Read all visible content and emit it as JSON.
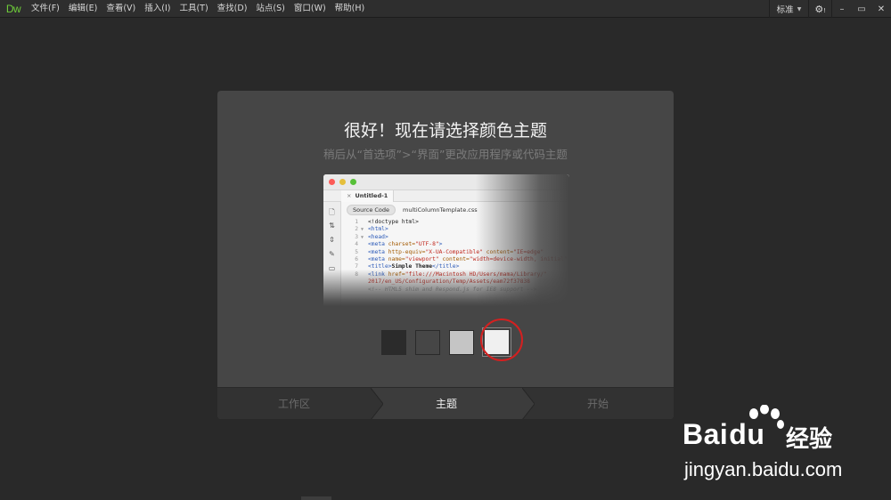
{
  "app": {
    "logo": "Dw"
  },
  "menu": [
    "文件(F)",
    "编辑(E)",
    "查看(V)",
    "插入(I)",
    "工具(T)",
    "查找(D)",
    "站点(S)",
    "窗口(W)",
    "帮助(H)"
  ],
  "toolbar_right": {
    "workspace": "标准",
    "settings_icon": "gear-icon",
    "minimize": "–",
    "restore": "▭",
    "close": "✕"
  },
  "dialog": {
    "title": "很好！现在请选择颜色主题",
    "subtitle": "稍后从“首选项”>“界面”更改应用程序或代码主题",
    "preview": {
      "tab": "Untitled-1",
      "tab_close": "×",
      "source_button": "Source Code",
      "related_file": "multiColumnTemplate.css",
      "code_lines": [
        {
          "n": "1",
          "fold": "",
          "html": "<span class='tx'>&lt;!doctype html&gt;</span>"
        },
        {
          "n": "2",
          "fold": "▼",
          "html": "<span class='tag'>&lt;html&gt;</span>"
        },
        {
          "n": "3",
          "fold": "▼",
          "html": "<span class='tag'>&lt;head&gt;</span>"
        },
        {
          "n": "4",
          "fold": "",
          "html": "<span class='tag'>&lt;meta</span> <span class='att'>charset=</span><span class='str'>\"UTF-8\"</span><span class='tag'>&gt;</span>"
        },
        {
          "n": "5",
          "fold": "",
          "html": "<span class='tag'>&lt;meta</span> <span class='att'>http-equiv=</span><span class='str'>\"X-UA-Compatible\"</span> <span class='att'>content=</span><span class='str'>\"IE=edge\"</span>"
        },
        {
          "n": "6",
          "fold": "",
          "html": "<span class='tag'>&lt;meta</span> <span class='att'>name=</span><span class='str'>\"viewport\"</span> <span class='att'>content=</span><span class='str'>\"width=device-width, initial\"</span>"
        },
        {
          "n": "7",
          "fold": "",
          "html": "<span class='tag'>&lt;title&gt;</span><span class='bk'>Simple Theme</span><span class='tag'>&lt;/title&gt;</span>"
        },
        {
          "n": "8",
          "fold": "",
          "html": "<span class='tag'>&lt;link</span> <span class='att'>href=</span><span class='str'>\"file:///Macintosh HD/Users/mama/Library/\"</span>"
        },
        {
          "n": "",
          "fold": "",
          "html": "<span class='str'>2017/en_US/Configuration/Temp/Assets/eam72f37838</span>"
        },
        {
          "n": "",
          "fold": "",
          "html": "<span class='cm'>&lt;!-- HTML5 shim and Respond.js for IE8 support --&gt;</span>"
        }
      ]
    },
    "themes": [
      {
        "name": "darkest",
        "color": "#2b2b2b"
      },
      {
        "name": "dark",
        "color": "#464646"
      },
      {
        "name": "light",
        "color": "#c5c5c5"
      },
      {
        "name": "lightest",
        "color": "#f0f0f0"
      }
    ],
    "selected_theme": "lightest",
    "highlight_color": "#d42020",
    "steps": [
      {
        "label": "工作区",
        "state": "done"
      },
      {
        "label": "主题",
        "state": "active"
      },
      {
        "label": "开始",
        "state": "next"
      }
    ]
  },
  "watermark": {
    "brand": "Bai",
    "brand_paw": "du",
    "cn": "经验",
    "url": "jingyan.baidu.com"
  }
}
